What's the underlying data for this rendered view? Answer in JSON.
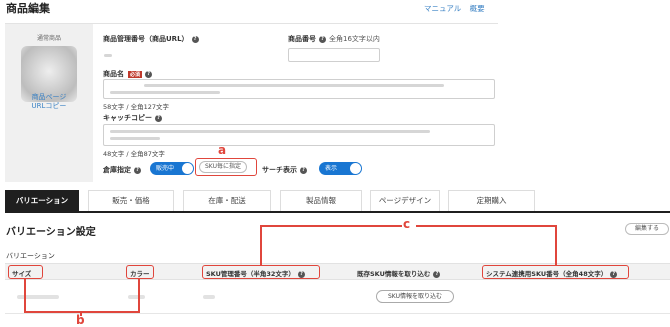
{
  "header": {
    "title": "商品編集",
    "links": [
      "マニュアル",
      "概要"
    ]
  },
  "product": {
    "thumb_label": "通常商品",
    "page_link_line1": "商品ページ",
    "page_link_line2": "URLコピー",
    "mgmt_label": "商品管理番号（商品URL）",
    "number_label": "商品番号",
    "number_hint": "全角16文字以内",
    "name_label": "商品名",
    "required_badge": "必須",
    "name_count": "58文字 / 全角127文字",
    "catch_label": "キャッチコピー",
    "catch_count": "48文字 / 全角87文字",
    "stock_label": "倉庫指定",
    "stock_toggle": "販売中",
    "sku_button": "SKU毎に指定",
    "search_label": "サーチ表示",
    "search_toggle": "表示"
  },
  "tabs": [
    "バリエーション",
    "販売・価格",
    "在庫・配送",
    "製品情報",
    "ページデザイン",
    "定期購入"
  ],
  "variation": {
    "title": "バリエーション設定",
    "edit_button": "編集する",
    "subtitle": "バリエーション",
    "columns": [
      "サイズ",
      "カラー",
      "SKU管理番号（半角32文字）",
      "既存SKU情報を取り込む",
      "システム連携用SKU番号（全角48文字）"
    ],
    "fetch_button": "SKU情報を取り込む"
  },
  "annotations": [
    "a",
    "b",
    "c"
  ],
  "colors": {
    "accent": "#1976d2",
    "highlight": "#e0463c",
    "link": "#3b82c4"
  }
}
